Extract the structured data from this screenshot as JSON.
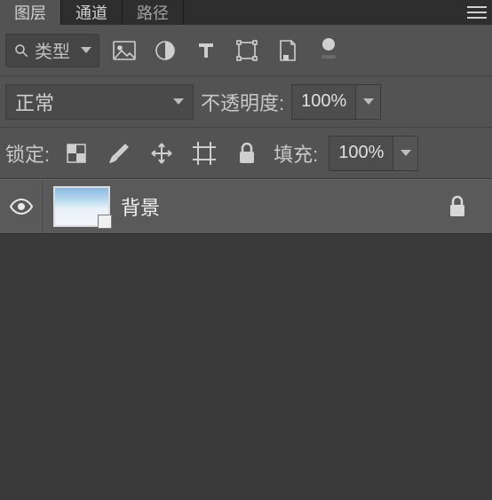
{
  "tabs": {
    "layers": "图层",
    "channels": "通道",
    "paths": "路径"
  },
  "filter": {
    "typeLabel": "类型",
    "icons": {
      "image": "image-layer-filter-icon",
      "adjust": "adjustment-layer-filter-icon",
      "text": "text-layer-filter-icon",
      "shape": "shape-layer-filter-icon",
      "smart": "smart-object-filter-icon"
    }
  },
  "blend": {
    "mode": "正常",
    "opacityLabel": "不透明度:",
    "opacityValue": "100%"
  },
  "lock": {
    "label": "锁定:",
    "fillLabel": "填充:",
    "fillValue": "100%"
  },
  "layers": [
    {
      "name": "背景",
      "visible": true,
      "locked": true
    }
  ]
}
